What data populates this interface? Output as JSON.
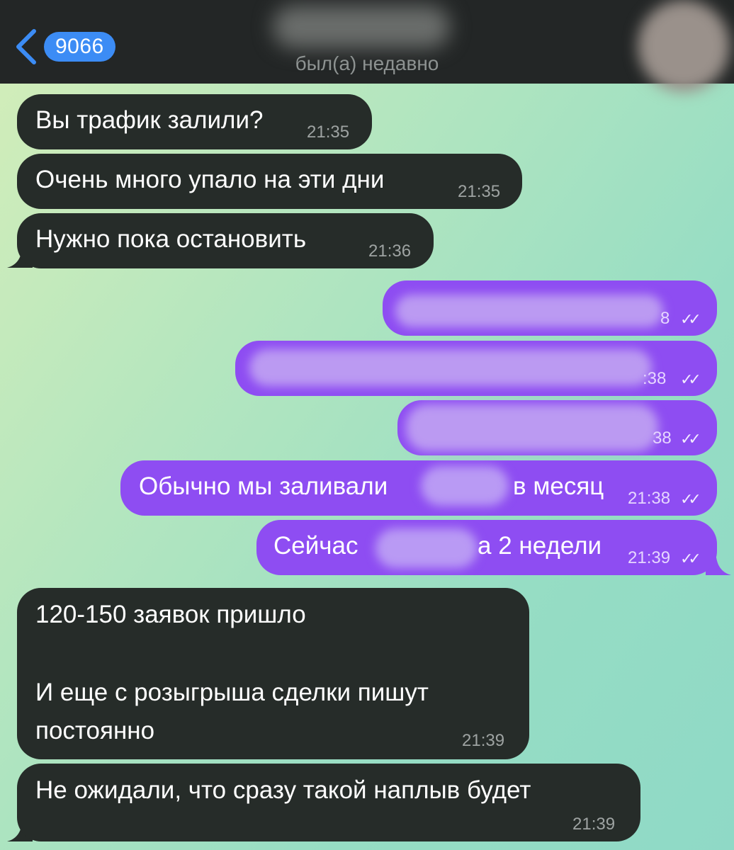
{
  "header": {
    "back_icon": "chevron-left-icon",
    "unread_count": "9066",
    "status": "был(а) недавно"
  },
  "messages": [
    {
      "text": "Вы трафик залили?",
      "time": "21:35"
    },
    {
      "text": "Очень много упало на эти дни",
      "time": "21:35"
    },
    {
      "text": "Нужно пока остановить",
      "time": "21:36"
    },
    {
      "time_partial": "8",
      "checks": "✓✓"
    },
    {
      "time_partial": ":38",
      "checks": "✓✓"
    },
    {
      "time_partial": "38",
      "checks": "✓✓"
    },
    {
      "text_before": "Обычно мы заливали",
      "text_after": "в месяц",
      "time": "21:38",
      "checks": "✓✓"
    },
    {
      "text_before": "Сейчас",
      "text_after": "а 2 недели",
      "time": "21:39",
      "checks": "✓✓"
    },
    {
      "line1": "120-150 заявок пришло",
      "line2": "И еще с розыгрыша сделки пишут",
      "line3": "постоянно",
      "time": "21:39"
    },
    {
      "text": "Не ожидали, что сразу такой наплыв будет",
      "time": "21:39"
    }
  ],
  "colors": {
    "incoming": "#262c29",
    "outgoing": "#8e4df2",
    "badge": "#3c8cf5",
    "header": "#232626"
  }
}
